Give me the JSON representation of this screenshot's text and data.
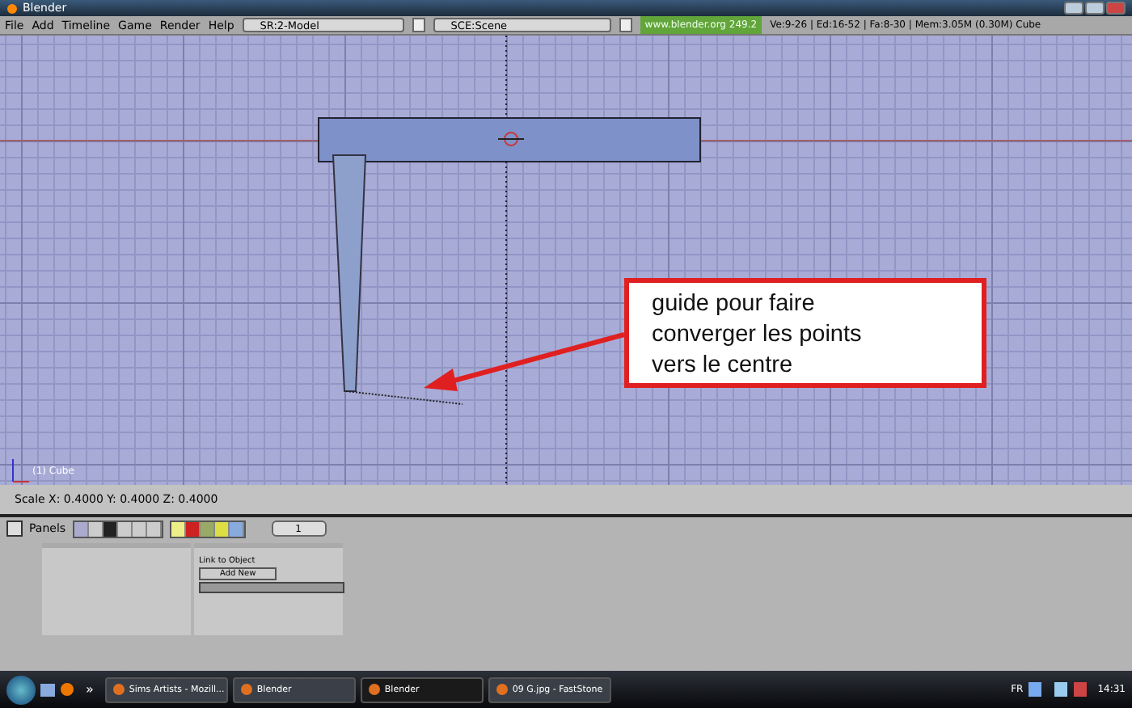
{
  "window": {
    "title": "Blender"
  },
  "menu": [
    {
      "label": "File"
    },
    {
      "label": "Add"
    },
    {
      "label": "Timeline"
    },
    {
      "label": "Game"
    },
    {
      "label": "Render"
    },
    {
      "label": "Help"
    }
  ],
  "screen_fields": [
    {
      "value": "SR:2-Model"
    },
    {
      "value": "SCE:Scene"
    }
  ],
  "site_link": "www.blender.org 249.2",
  "stats": "Ve:9-26 | Ed:16-52 | Fa:8-30 | Mem:3.05M (0.30M) Cube",
  "viewport": {
    "object_label": "(1) Cube",
    "annotation": "guide pour faire converger les points vers le centre"
  },
  "status": "Scale X: 0.4000  Y: 0.4000  Z: 0.4000",
  "buttons_window": {
    "panels_label": "Panels",
    "page": "1",
    "link_title": "Link to Object",
    "add_new": "Add New"
  },
  "taskbar": {
    "quick_launch": "»",
    "items": [
      {
        "label": "Sims Artists - Mozill...",
        "selected": false
      },
      {
        "label": "Blender",
        "selected": false
      },
      {
        "label": "Blender",
        "selected": true
      },
      {
        "label": "09 G.jpg - FastStone",
        "selected": false
      }
    ],
    "language": "FR",
    "time": "14:31"
  }
}
